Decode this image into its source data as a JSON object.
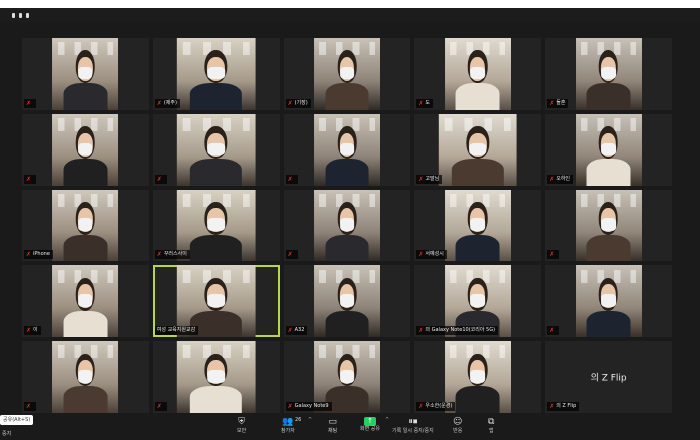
{
  "participants": [
    {
      "name": "",
      "muted": true,
      "dark": false
    },
    {
      "name": "(제주)",
      "muted": true,
      "dark": false
    },
    {
      "name": "(기장)",
      "muted": true,
      "dark": false
    },
    {
      "name": "도",
      "muted": true,
      "dark": false
    },
    {
      "name": "돌혼",
      "muted": true,
      "dark": false
    },
    {
      "name": "",
      "muted": true,
      "dark": false
    },
    {
      "name": "",
      "muted": true,
      "dark": false
    },
    {
      "name": "",
      "muted": true,
      "dark": false
    },
    {
      "name": "고말님",
      "muted": true,
      "dark": false
    },
    {
      "name": "오하인",
      "muted": true,
      "dark": false
    },
    {
      "name": "iPhone",
      "muted": true,
      "dark": false
    },
    {
      "name": "꾸러스사이",
      "muted": true,
      "dark": false
    },
    {
      "name": "",
      "muted": true,
      "dark": false
    },
    {
      "name": "서예성시",
      "muted": true,
      "dark": false
    },
    {
      "name": "",
      "muted": true,
      "dark": false
    },
    {
      "name": "이",
      "muted": true,
      "dark": false
    },
    {
      "name": "여성 교육지원교감",
      "muted": false,
      "dark": false,
      "active": true
    },
    {
      "name": "A32",
      "muted": true,
      "dark": false
    },
    {
      "name": "의 Galaxy Note10(코리아 5G)",
      "muted": true,
      "dark": false
    },
    {
      "name": "",
      "muted": true,
      "dark": false
    },
    {
      "name": "",
      "muted": true,
      "dark": false
    },
    {
      "name": "",
      "muted": true,
      "dark": false
    },
    {
      "name": "Galaxy Note9",
      "muted": true,
      "dark": false
    },
    {
      "name": "우소한(운경)",
      "muted": true,
      "dark": false
    },
    {
      "name": "의 Z Flip",
      "muted": true,
      "dark": true,
      "center": "의 Z Flip"
    }
  ],
  "toolbar": {
    "kbd_hint": "공유(Alt+S)",
    "stop_label": "중지",
    "items": [
      {
        "icon": "shield",
        "label": "보안"
      },
      {
        "icon": "participants",
        "label": "참가자",
        "count": "26"
      },
      {
        "icon": "chat",
        "label": "채팅"
      },
      {
        "icon": "share",
        "label": "화면 공유"
      },
      {
        "icon": "record",
        "label": "기록 일시 중지/중지"
      },
      {
        "icon": "reaction",
        "label": "반응"
      },
      {
        "icon": "apps",
        "label": "앱"
      }
    ]
  },
  "colors": {
    "active_outline": "#b6d74a",
    "muted_mic": "#e0332d",
    "share_green": "#23d160"
  }
}
